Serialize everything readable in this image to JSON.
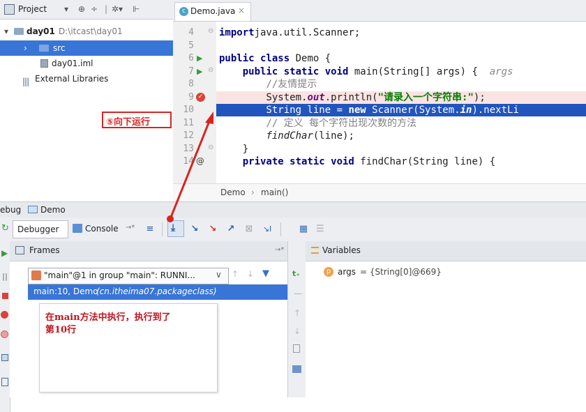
{
  "project": {
    "header": {
      "label": "Project",
      "dropdown": "▾",
      "icons": [
        "⊕",
        "÷",
        "✲▾",
        "⊩"
      ]
    },
    "tree": [
      {
        "arrow": "▾",
        "name": "day01",
        "path": "D:\\itcast\\day01"
      },
      {
        "arrow": "›",
        "name": "src"
      },
      {
        "name": "day01.iml"
      },
      {
        "name": "External Libraries"
      }
    ]
  },
  "editor": {
    "tab": {
      "label": "Demo.java",
      "close": "×"
    },
    "lines": [
      {
        "num": "4",
        "code": [
          [
            "kw",
            "import"
          ],
          [
            "",
            "java.util.Scanner;"
          ]
        ]
      },
      {
        "num": "5",
        "code": []
      },
      {
        "num": "6",
        "code": [
          [
            "kw",
            "public class"
          ],
          [
            "",
            " Demo {"
          ]
        ]
      },
      {
        "num": "7",
        "code": [
          [
            "",
            "    "
          ],
          [
            "kw",
            "public static void"
          ],
          [
            "",
            " main(String[] args) {  "
          ],
          [
            "hint",
            "args"
          ]
        ]
      },
      {
        "num": "8",
        "code": [
          [
            "",
            "        "
          ],
          [
            "cmt",
            "//友情提示"
          ]
        ]
      },
      {
        "num": "9",
        "code": [
          [
            "",
            "        System."
          ],
          [
            "fld",
            "out"
          ],
          [
            "",
            ".println("
          ],
          [
            "str",
            "\"请录入一个字符串:\""
          ],
          [
            "",
            ");"
          ]
        ]
      },
      {
        "num": "10",
        "code": [
          [
            "",
            "        String line = "
          ],
          [
            "kw",
            "new"
          ],
          [
            "",
            " Scanner(System."
          ],
          [
            "fld",
            "in"
          ],
          [
            "",
            ").nextLi"
          ]
        ]
      },
      {
        "num": "11",
        "code": [
          [
            "",
            "        "
          ],
          [
            "cmt",
            "// 定义 每个字符出现次数的方法"
          ]
        ]
      },
      {
        "num": "12",
        "code": [
          [
            "",
            "        "
          ],
          [
            "it",
            "findChar"
          ],
          [
            "",
            "(line);"
          ]
        ]
      },
      {
        "num": "13",
        "code": [
          [
            "",
            "    }"
          ]
        ]
      },
      {
        "num": "14",
        "code": [
          [
            "",
            "    "
          ],
          [
            "kw",
            "private static void"
          ],
          [
            "",
            " findChar(String line) {"
          ]
        ]
      }
    ],
    "breadcrumb": {
      "class": "Demo",
      "sep": "›",
      "method": "main()"
    }
  },
  "annotation_step": "⑤向下运行",
  "debug": {
    "title": {
      "prefix": "ebug",
      "config": "Demo"
    },
    "tabs": {
      "debugger": "Debugger",
      "console": "Console",
      "console_suffix": "→*"
    },
    "frames": {
      "header": "Frames",
      "header_pin": "→*",
      "thread_select": "\"main\"@1 in group \"main\": RUNNI...",
      "selected_frame": "main:10, Demo",
      "selected_frame_pkg": "(cn.itheima07.packageclass)",
      "note_line1": "在main方法中执行，执行到了",
      "note_line2": "第10行"
    },
    "variables": {
      "header": "Variables",
      "items": [
        {
          "badge": "p",
          "name": "args",
          "value": "= {String[0]@669}"
        }
      ]
    }
  },
  "colors": {
    "accent": "#3875d7",
    "exec_line": "#2154bd",
    "breakpoint_line": "#fae3e3",
    "annotation_red": "#d9231f",
    "note_text": "#c0141e"
  }
}
